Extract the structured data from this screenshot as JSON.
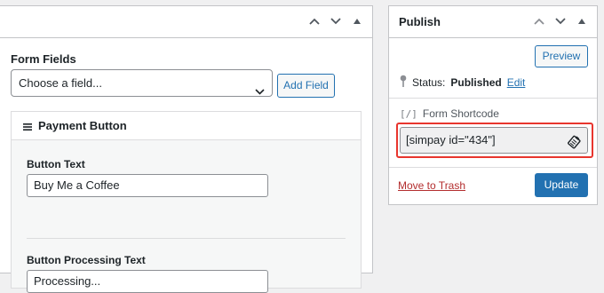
{
  "form_fields_panel": {
    "label": "Form Fields",
    "select_value": "Choose a field...",
    "add_field_label": "Add Field",
    "payment_button": {
      "title": "Payment Button",
      "button_text_label": "Button Text",
      "button_text_value": "Buy Me a Coffee",
      "processing_text_label": "Button Processing Text",
      "processing_text_value": "Processing..."
    }
  },
  "publish_panel": {
    "title": "Publish",
    "preview_label": "Preview",
    "status_label": "Status:",
    "status_value": "Published",
    "status_edit": "Edit",
    "shortcode_icon": "[/]",
    "shortcode_label": "Form Shortcode",
    "shortcode_value": "[simpay id=\"434\"]",
    "trash_label": "Move to Trash",
    "update_label": "Update"
  },
  "colors": {
    "accent": "#2271b1",
    "highlight": "#e8352e",
    "trash": "#b32d2e"
  }
}
